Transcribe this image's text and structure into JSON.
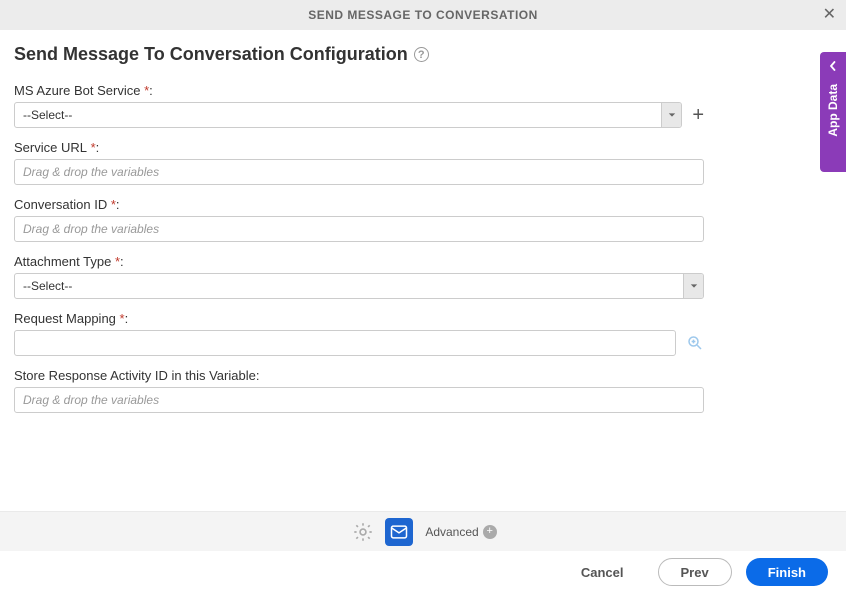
{
  "header": {
    "title": "SEND MESSAGE TO CONVERSATION"
  },
  "sidebar": {
    "app_data_label": "App Data"
  },
  "page": {
    "title": "Send Message To Conversation Configuration"
  },
  "fields": {
    "azure_bot": {
      "label": "MS Azure Bot Service",
      "required_mark": "*",
      "colon": ":",
      "value": "--Select--"
    },
    "service_url": {
      "label": "Service URL",
      "required_mark": "*",
      "colon": ":",
      "placeholder": "Drag & drop the variables",
      "value": ""
    },
    "conversation_id": {
      "label": "Conversation ID",
      "required_mark": "*",
      "colon": ":",
      "placeholder": "Drag & drop the variables",
      "value": ""
    },
    "attachment_type": {
      "label": "Attachment Type",
      "required_mark": "*",
      "colon": ":",
      "value": "--Select--"
    },
    "request_mapping": {
      "label": "Request Mapping",
      "required_mark": "*",
      "colon": ":",
      "value": ""
    },
    "store_response": {
      "label": "Store Response Activity ID in this Variable:",
      "placeholder": "Drag & drop the variables",
      "value": ""
    }
  },
  "tabs": {
    "advanced_label": "Advanced"
  },
  "buttons": {
    "cancel": "Cancel",
    "prev": "Prev",
    "finish": "Finish"
  },
  "colors": {
    "accent_purple": "#8b3bb8",
    "accent_blue": "#0b6be8",
    "tab_active_blue": "#1e66d0"
  }
}
